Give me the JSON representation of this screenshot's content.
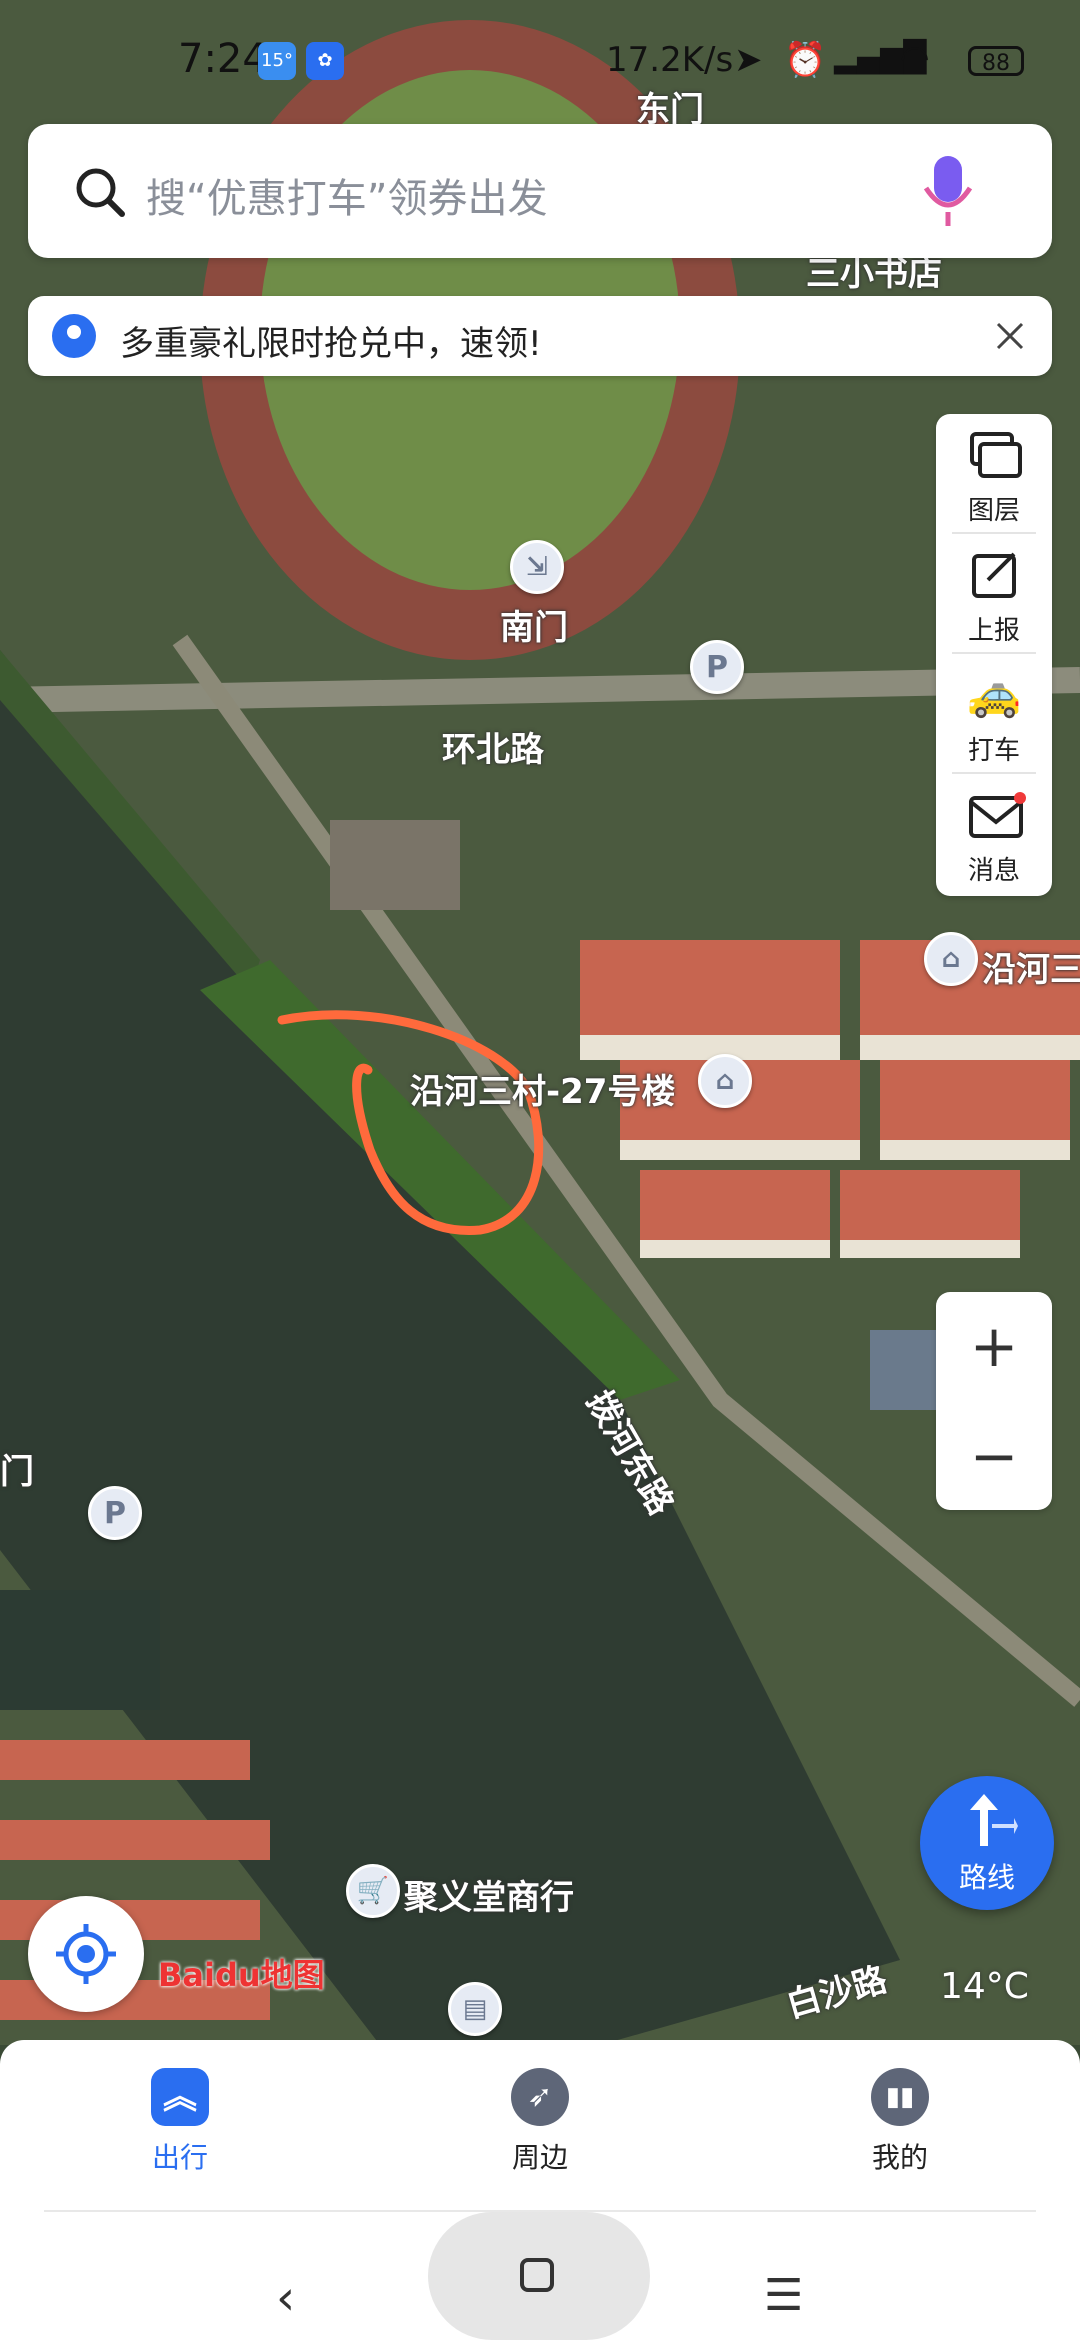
{
  "status_bar": {
    "time": "7:24",
    "weather_badge": "15°",
    "network_speed": "17.2K/s",
    "battery": "88"
  },
  "search": {
    "placeholder": "搜“优惠打车”领券出发"
  },
  "promo_banner": {
    "text": "多重豪礼限时抢兑中，速领!"
  },
  "toolbar": {
    "layers": "图层",
    "report": "上报",
    "taxi": "打车",
    "messages": "消息"
  },
  "map_labels": {
    "east_gate": "东门",
    "bookstore": "三小书店",
    "south_gate": "南门",
    "huanbei_road": "环北路",
    "building": "沿河三村-27号楼",
    "village": "沿河三",
    "hedong_road": "拨河东路",
    "gate_left": "门",
    "shop": "聚义堂商行",
    "baisha_road": "白沙路"
  },
  "zoom": {
    "in": "+",
    "out": "−"
  },
  "route_button": {
    "label": "路线"
  },
  "logo": {
    "text": "Baidu地图"
  },
  "temperature": "14°C",
  "bottom_nav": {
    "items": [
      {
        "label": "出行",
        "active": true
      },
      {
        "label": "周边",
        "active": false
      },
      {
        "label": "我的",
        "active": false
      }
    ]
  },
  "colors": {
    "accent": "#2a6ef0",
    "annotation": "#ff6a3c"
  }
}
